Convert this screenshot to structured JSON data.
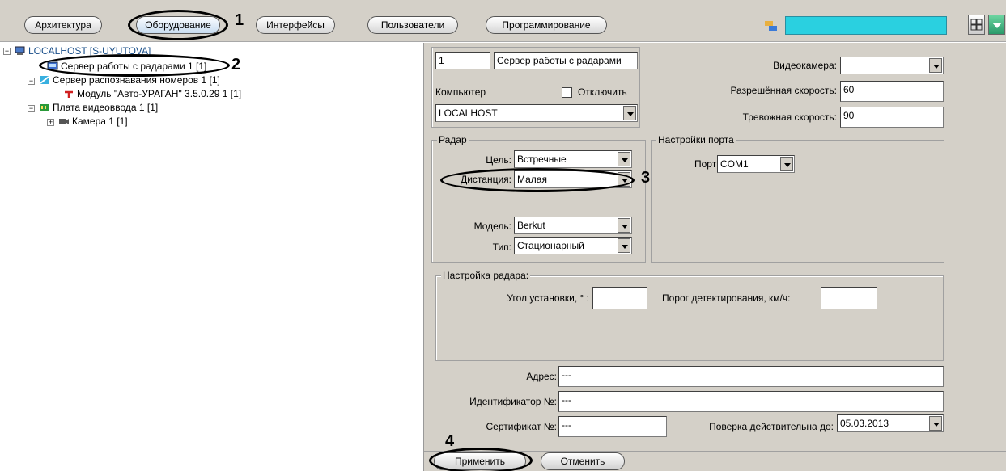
{
  "tabs": [
    "Архитектура",
    "Оборудование",
    "Интерфейсы",
    "Пользователи",
    "Программирование"
  ],
  "callouts": [
    "1",
    "2",
    "3",
    "4"
  ],
  "tree": {
    "root": "LOCALHOST [S-UYUTOVA]",
    "radar_server": "Сервер работы с радарами 1 [1]",
    "lpr_server": "Сервер распознавания номеров 1 [1]",
    "module": "Модуль \"Авто-УРАГАН\" 3.5.0.29 1 [1]",
    "capture_board": "Плата видеоввода 1 [1]",
    "camera": "Камера 1 [1]"
  },
  "form": {
    "id": "1",
    "name": "Сервер работы с радарами",
    "computer_label": "Компьютер",
    "disable_label": "Отключить",
    "computer_value": "LOCALHOST",
    "camera_label": "Видеокамера:",
    "camera_value": "",
    "allowed_speed_label": "Разрешённая скорость:",
    "allowed_speed": "60",
    "alarm_speed_label": "Тревожная скорость:",
    "alarm_speed": "90",
    "radar_group": "Радар",
    "target_label": "Цель:",
    "target_value": "Встречные",
    "distance_label": "Дистанция:",
    "distance_value": "Малая",
    "model_label": "Модель:",
    "model_value": "Berkut",
    "type_label": "Тип:",
    "type_value": "Стационарный",
    "port_group": "Настройки порта",
    "port_label": "Порт",
    "port_value": "COM1",
    "radar_settings_group": "Настройка радара:",
    "angle_label": "Угол установки, ° :",
    "angle_value": "",
    "threshold_label": "Порог детектирования, км/ч:",
    "threshold_value": "",
    "address_label": "Адрес:",
    "address_value": "---",
    "identifier_label": "Идентификатор №:",
    "identifier_value": "---",
    "certificate_label": "Сертификат №:",
    "certificate_value": "---",
    "verification_label": "Поверка действительна до:",
    "verification_value": "05.03.2013"
  },
  "buttons": {
    "apply": "Применить",
    "cancel": "Отменить"
  },
  "colors": {
    "search_fill": "#2ad0e0",
    "panel": "#d4d0c8"
  }
}
